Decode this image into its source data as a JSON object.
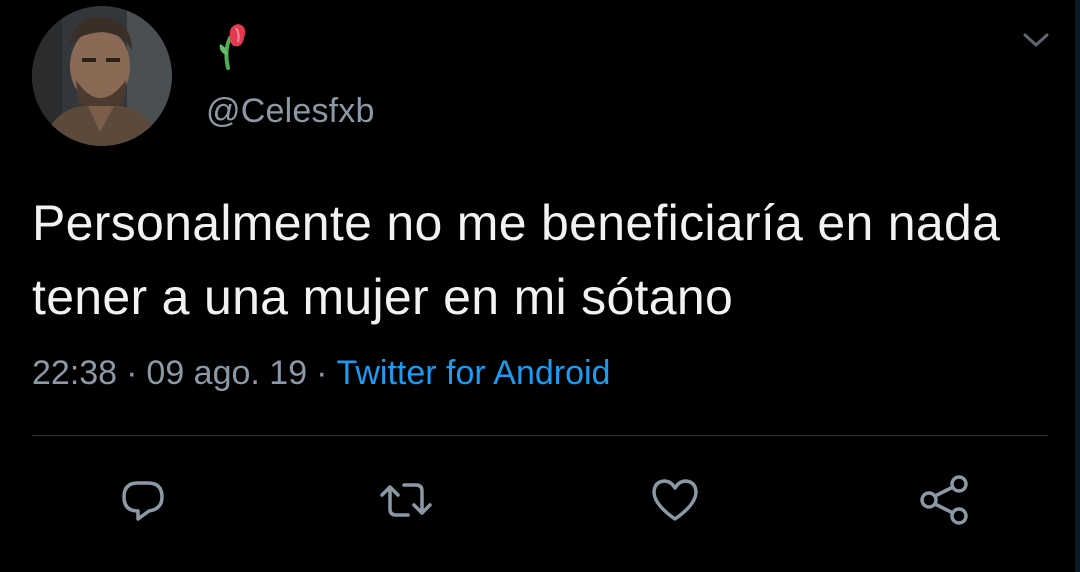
{
  "user": {
    "handle": "@Celesfxb",
    "display_name_icon": "wilted-flower-emoji",
    "avatar": "profile-photo"
  },
  "tweet": {
    "text": "Personalmente no me beneficiaría en nada tener a una mujer en mi sótano",
    "time": "22:38",
    "date": "09 ago. 19",
    "separator": "·",
    "source": "Twitter for Android"
  },
  "actions": [
    {
      "name": "reply",
      "icon": "reply-icon"
    },
    {
      "name": "retweet",
      "icon": "retweet-icon"
    },
    {
      "name": "like",
      "icon": "heart-icon"
    },
    {
      "name": "share",
      "icon": "share-icon"
    }
  ],
  "colors": {
    "background": "#000000",
    "text": "#f2f2f2",
    "muted": "#8b98a5",
    "link": "#1d9bf0",
    "divider": "#2f3336"
  }
}
